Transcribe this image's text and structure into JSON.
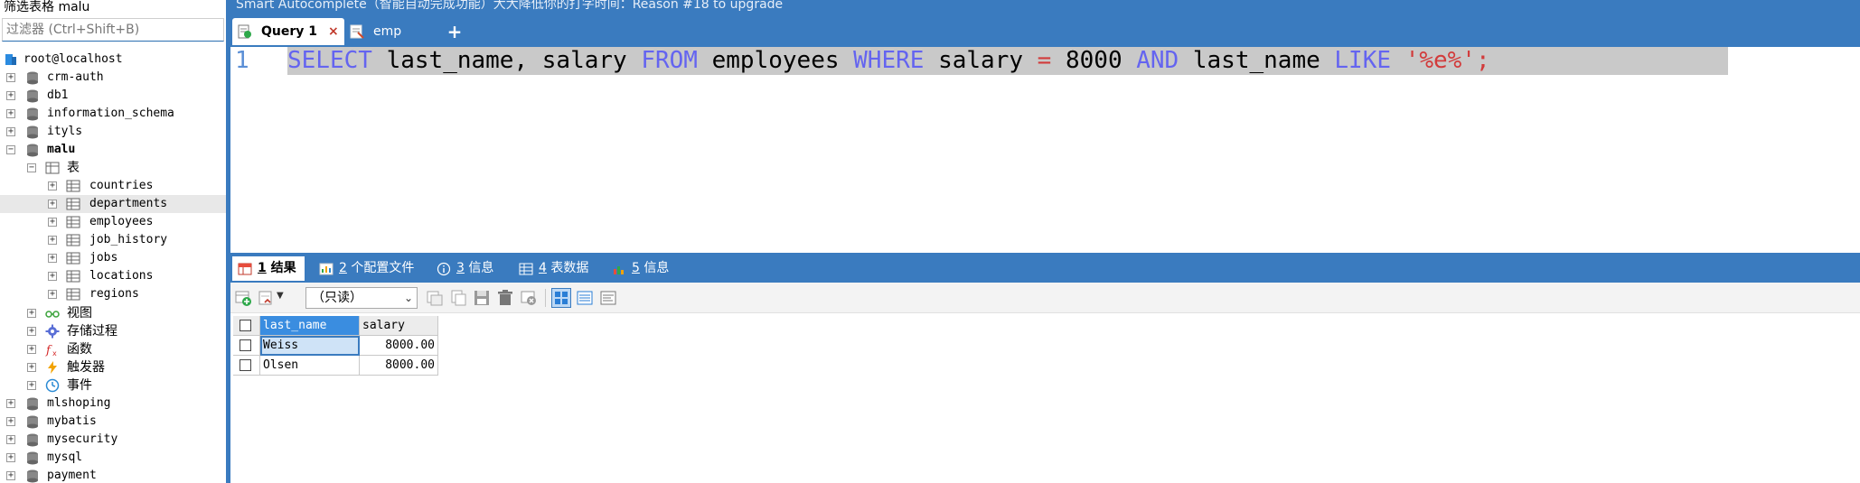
{
  "sidebar": {
    "filter_label": "筛选表格 malu",
    "filter_placeholder": "过滤器 (Ctrl+Shift+B)",
    "connection": "root@localhost",
    "databases": [
      {
        "name": "crm-auth"
      },
      {
        "name": "db1"
      },
      {
        "name": "information_schema"
      },
      {
        "name": "ityls"
      },
      {
        "name": "malu"
      }
    ],
    "malu_children": {
      "tables_label": "表",
      "tables": [
        "countries",
        "departments",
        "employees",
        "job_history",
        "jobs",
        "locations",
        "regions"
      ],
      "views_label": "视图",
      "procedures_label": "存储过程",
      "functions_label": "函数",
      "triggers_label": "触发器",
      "events_label": "事件"
    },
    "more_databases": [
      "mlshoping",
      "mybatis",
      "mysecurity",
      "mysql",
      "payment"
    ]
  },
  "header": {
    "promo_text": "Smart Autocomplete（智能自动完成功能）大大降低你的打字时间：Reason #18 to upgrade",
    "tabs": [
      {
        "label": "Query 1",
        "close": "×"
      },
      {
        "label": "emp"
      }
    ],
    "add_tab": "+"
  },
  "editor": {
    "line_number": "1",
    "tokens": {
      "t1": "SELECT",
      "t2": " last_name, salary ",
      "t3": "FROM",
      "t4": " employees ",
      "t5": "WHERE",
      "t6": " salary ",
      "t7": "=",
      "t8": " 8000 ",
      "t9": "AND",
      "t10": " last_name ",
      "t11": "LIKE",
      "t12": " ",
      "t13": "'%e%'",
      "t14": ";"
    }
  },
  "results": {
    "tabs": [
      {
        "num": "1",
        "label": "结果"
      },
      {
        "num": "2",
        "label": "个配置文件"
      },
      {
        "num": "3",
        "label": "信息"
      },
      {
        "num": "4",
        "label": "表数据"
      },
      {
        "num": "5",
        "label": "信息"
      }
    ],
    "mode": "（只读）",
    "columns": [
      "last_name",
      "salary"
    ],
    "rows": [
      {
        "last_name": "Weiss",
        "salary": "8000.00"
      },
      {
        "last_name": "Olsen",
        "salary": "8000.00"
      }
    ]
  },
  "colors": {
    "accent": "#3a7bbf",
    "keyword": "#6464f0",
    "string": "#d23b3b"
  }
}
